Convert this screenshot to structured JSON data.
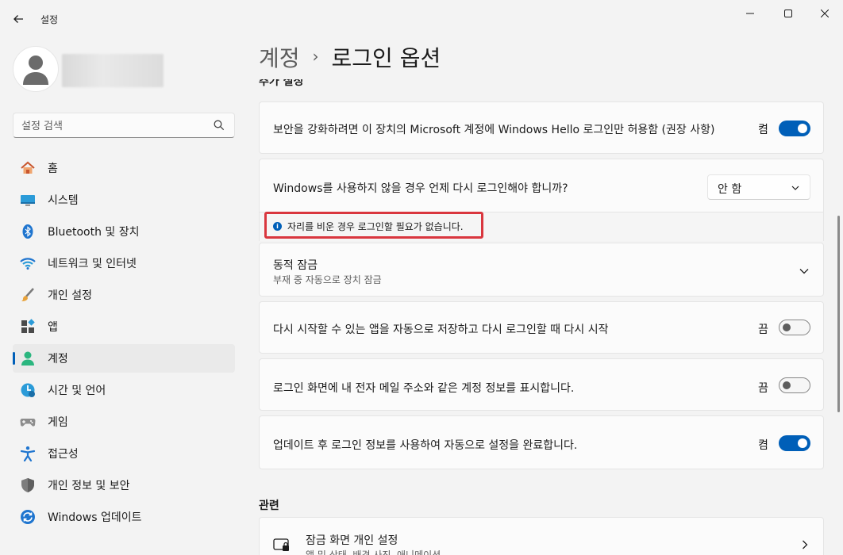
{
  "window": {
    "title": "설정",
    "back_icon": "arrow-left-icon",
    "controls": [
      "minimize-icon",
      "maximize-icon",
      "close-icon"
    ]
  },
  "sidebar": {
    "search_placeholder": "설정 검색",
    "items": [
      {
        "label": "홈",
        "icon": "home-icon",
        "active": false
      },
      {
        "label": "시스템",
        "icon": "monitor-icon",
        "active": false
      },
      {
        "label": "Bluetooth 및 장치",
        "icon": "bluetooth-icon",
        "active": false
      },
      {
        "label": "네트워크 및 인터넷",
        "icon": "wifi-icon",
        "active": false
      },
      {
        "label": "개인 설정",
        "icon": "brush-icon",
        "active": false
      },
      {
        "label": "앱",
        "icon": "apps-icon",
        "active": false
      },
      {
        "label": "계정",
        "icon": "person-icon",
        "active": true
      },
      {
        "label": "시간 및 언어",
        "icon": "clock-globe-icon",
        "active": false
      },
      {
        "label": "게임",
        "icon": "gamepad-icon",
        "active": false
      },
      {
        "label": "접근성",
        "icon": "accessibility-icon",
        "active": false
      },
      {
        "label": "개인 정보 및 보안",
        "icon": "shield-icon",
        "active": false
      },
      {
        "label": "Windows 업데이트",
        "icon": "update-icon",
        "active": false
      }
    ]
  },
  "breadcrumb": {
    "parent": "계정",
    "separator": "›",
    "current": "로그인 옵션"
  },
  "main": {
    "section_partial": "추가 설정",
    "settings": {
      "hello_only": {
        "label": "보안을 강화하려면 이 장치의 Microsoft 계정에 Windows Hello 로그인만 허용함 (권장 사항)",
        "state": "켬",
        "on": true
      },
      "relogin": {
        "label": "Windows를 사용하지 않을 경우 언제 다시 로그인해야 합니까?",
        "value": "안 함"
      },
      "info_text": "자리를 비운 경우 로그인할 필요가 없습니다.",
      "dynamic_lock": {
        "label": "동적 잠금",
        "sub": "부재 중 자동으로 장치 잠금"
      },
      "restart_apps": {
        "label": "다시 시작할 수 있는 앱을 자동으로 저장하고 다시 로그인할 때 다시 시작",
        "state": "끔",
        "on": false
      },
      "show_account": {
        "label": "로그인 화면에 내 전자 메일 주소와 같은 계정 정보를 표시합니다.",
        "state": "끔",
        "on": false
      },
      "auto_finish": {
        "label": "업데이트 후 로그인 정보를 사용하여 자동으로 설정을 완료합니다.",
        "state": "켬",
        "on": true
      }
    },
    "related_title": "관련",
    "lock_screen": {
      "label": "잠금 화면 개인 설정",
      "sub": "앱 및 상태, 배경 사진, 애니메이션"
    }
  },
  "colors": {
    "accent": "#005fb8",
    "highlight": "#d9363e"
  }
}
